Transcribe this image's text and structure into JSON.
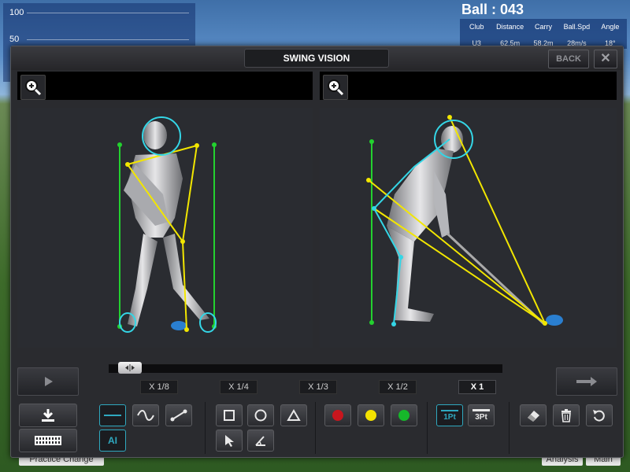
{
  "background": {
    "chart_ticks": [
      "100",
      "50"
    ],
    "ball_count": "Ball : 043",
    "stats_headers": [
      "Club",
      "Distance",
      "Carry",
      "Ball.Spd",
      "Angle"
    ],
    "stats_values": [
      "U3",
      "62.5m",
      "58.2m",
      "28m/s",
      "18°"
    ],
    "bottom_left_button": "Practice Change",
    "bottom_right_button_1": "Analysis",
    "bottom_right_button_2": "Main"
  },
  "dialog": {
    "title": "SWING VISION",
    "back_label": "BACK",
    "close_label": "✕"
  },
  "speeds": [
    "X 1/8",
    "X 1/4",
    "X 1/3",
    "X 1/2",
    "X 1"
  ],
  "active_speed": "X 1",
  "tools": {
    "ai_label": "AI",
    "pt1_label": "1Pt",
    "pt3_label": "3Pt"
  },
  "colors": {
    "accent": "#2fa8bf",
    "line_yellow": "#f2e600",
    "line_green": "#23d12f",
    "line_cyan": "#34d6e6",
    "red": "#c8161e",
    "yellow": "#f4e200",
    "green": "#16b82a"
  },
  "timeline": {
    "slider_position": 0.0
  }
}
